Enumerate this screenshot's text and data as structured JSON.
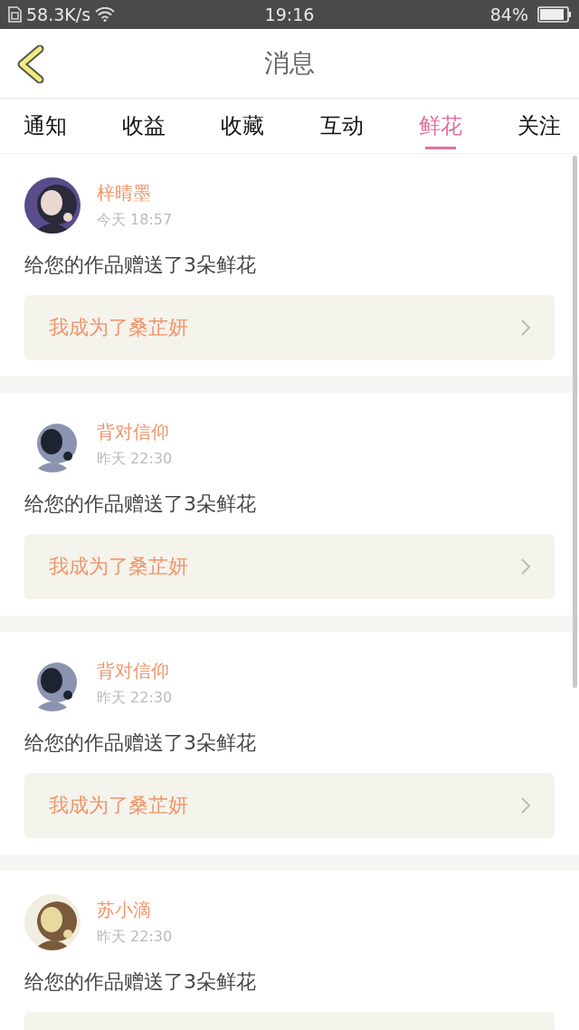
{
  "status_bar": {
    "speed": "58.3K/s",
    "time": "19:16",
    "battery": "84%"
  },
  "header": {
    "title": "消息"
  },
  "tabs": [
    {
      "label": "通知",
      "selected": false
    },
    {
      "label": "收益",
      "selected": false
    },
    {
      "label": "收藏",
      "selected": false
    },
    {
      "label": "互动",
      "selected": false
    },
    {
      "label": "鲜花",
      "selected": true
    },
    {
      "label": "关注",
      "selected": false
    }
  ],
  "messages": [
    {
      "user": "梓晴墨",
      "time": "今天 18:57",
      "text": "给您的作品赠送了3朵鲜花",
      "work": "我成为了桑芷妍"
    },
    {
      "user": "背对信仰",
      "time": "昨天 22:30",
      "text": "给您的作品赠送了3朵鲜花",
      "work": "我成为了桑芷妍"
    },
    {
      "user": "背对信仰",
      "time": "昨天 22:30",
      "text": "给您的作品赠送了3朵鲜花",
      "work": "我成为了桑芷妍"
    },
    {
      "user": "苏小滴",
      "time": "昨天 22:30",
      "text": "给您的作品赠送了3朵鲜花"
    }
  ]
}
